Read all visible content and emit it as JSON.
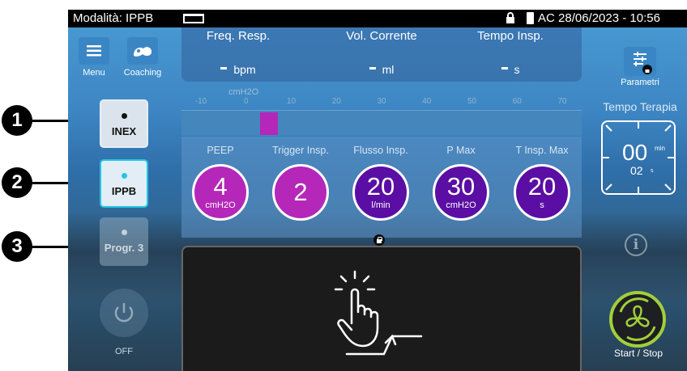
{
  "status_bar": {
    "mode": "Modalità: IPPB",
    "ac_date": "AC 28/06/2023 - 10:56"
  },
  "top_buttons": {
    "menu": "Menu",
    "coaching": "Coaching",
    "parametri": "Parametri"
  },
  "measurements": [
    {
      "label": "Freq. Resp.",
      "unit": "bpm"
    },
    {
      "label": "Vol. Corrente",
      "unit": "ml"
    },
    {
      "label": "Tempo Insp.",
      "unit": "s"
    }
  ],
  "pressure_scale": {
    "unit": "cmH2O",
    "ticks": [
      "-10",
      "0",
      "10",
      "20",
      "30",
      "40",
      "50",
      "60",
      "70"
    ],
    "indicator_value": 5
  },
  "settings": [
    {
      "label": "PEEP",
      "value": "4",
      "unit": "cmH2O",
      "color": "#b427b8"
    },
    {
      "label": "Trigger Insp.",
      "value": "2",
      "unit": "",
      "color": "#b427b8"
    },
    {
      "label": "Flusso Insp.",
      "value": "20",
      "unit": "l/min",
      "color": "#5b0ea3"
    },
    {
      "label": "P Max",
      "value": "30",
      "unit": "cmH2O",
      "color": "#5b0ea3"
    },
    {
      "label": "T Insp. Max",
      "value": "20",
      "unit": "s",
      "color": "#5b0ea3"
    }
  ],
  "mode_buttons": [
    {
      "label": "INEX",
      "state": "normal"
    },
    {
      "label": "IPPB",
      "state": "selected"
    },
    {
      "label": "Progr. 3",
      "state": "disabled"
    }
  ],
  "callouts": [
    "1",
    "2",
    "3"
  ],
  "off_label": "OFF",
  "therapy_time": {
    "label": "Tempo Terapia",
    "minutes": "00",
    "minutes_unit": "min",
    "seconds": "02",
    "seconds_unit": "s"
  },
  "start_stop_label": "Start / Stop",
  "colors": {
    "accent_blue": "#3a86c5",
    "start_ring": "#a2cf3a",
    "selected_mode": "#22c5e5"
  }
}
